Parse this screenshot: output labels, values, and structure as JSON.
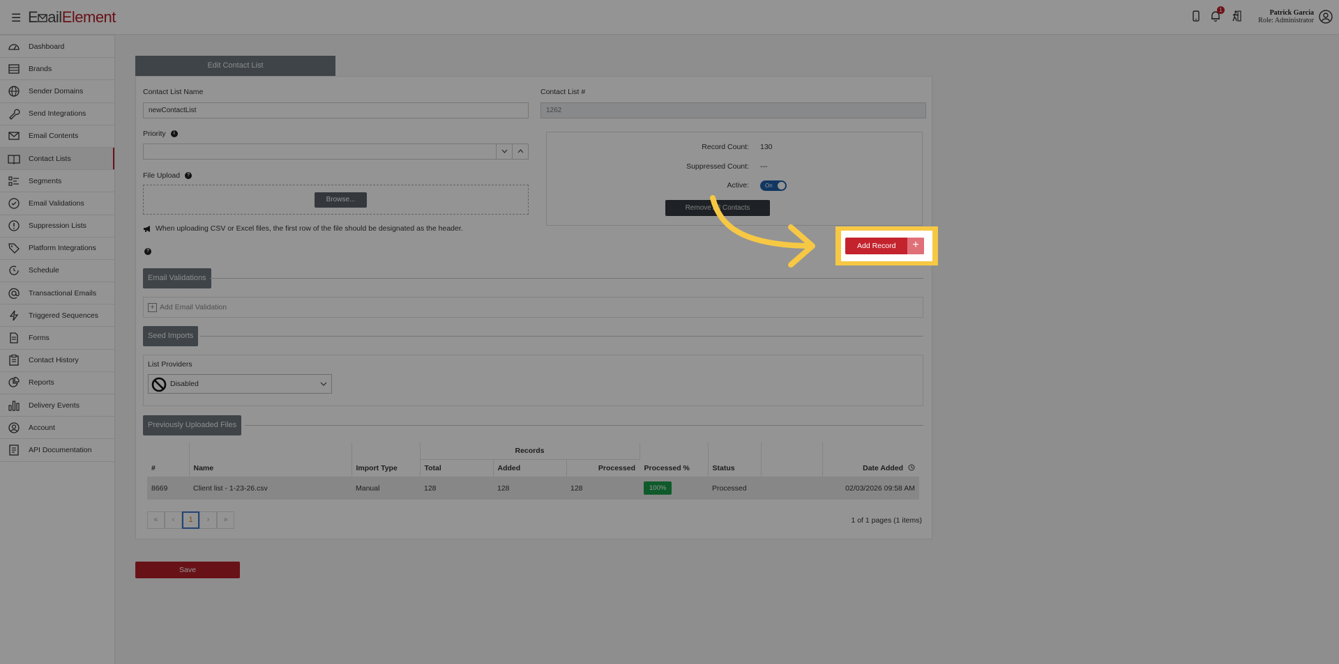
{
  "app": {
    "logo_part1": "E",
    "logo_part2": "ail",
    "logo_part3": "Element",
    "notification_count": "1",
    "user_name": "Patrick Garcia",
    "user_role": "Role: Administrator"
  },
  "sidebar": {
    "items": [
      {
        "label": "Dashboard",
        "icon": "dashboard-icon"
      },
      {
        "label": "Brands",
        "icon": "brands-icon"
      },
      {
        "label": "Sender Domains",
        "icon": "globe-icon"
      },
      {
        "label": "Send Integrations",
        "icon": "wrench-icon"
      },
      {
        "label": "Email Contents",
        "icon": "envelope-icon"
      },
      {
        "label": "Contact Lists",
        "icon": "book-icon"
      },
      {
        "label": "Segments",
        "icon": "segments-icon"
      },
      {
        "label": "Email Validations",
        "icon": "check-circle-icon"
      },
      {
        "label": "Suppression Lists",
        "icon": "exclamation-circle-icon"
      },
      {
        "label": "Platform Integrations",
        "icon": "tag-icon"
      },
      {
        "label": "Schedule",
        "icon": "schedule-icon"
      },
      {
        "label": "Transactional Emails",
        "icon": "at-icon"
      },
      {
        "label": "Triggered Sequences",
        "icon": "bolt-icon"
      },
      {
        "label": "Forms",
        "icon": "form-icon"
      },
      {
        "label": "Contact History",
        "icon": "clipboard-icon"
      },
      {
        "label": "Reports",
        "icon": "pie-chart-icon"
      },
      {
        "label": "Delivery Events",
        "icon": "bar-chart-icon"
      },
      {
        "label": "Account",
        "icon": "account-icon"
      },
      {
        "label": "API Documentation",
        "icon": "api-doc-icon"
      }
    ],
    "active_index": 5
  },
  "form": {
    "tab_title": "Edit Contact List",
    "name_label": "Contact List Name",
    "name_value": "newContactList",
    "number_label": "Contact List #",
    "number_value": "1262",
    "priority_label": "Priority",
    "priority_value": "",
    "file_upload_label": "File Upload",
    "browse_label": "Browse...",
    "upload_note": "When uploading CSV or Excel files, the first row of the file should be designated as the header."
  },
  "stats": {
    "record_count_label": "Record Count:",
    "record_count_value": "130",
    "suppressed_label": "Suppressed Count:",
    "suppressed_value": "---",
    "active_label": "Active:",
    "active_toggle": "On",
    "remove_all_label": "Remove All Contacts"
  },
  "validations": {
    "heading": "Email Validations",
    "add_label": "Add Email Validation"
  },
  "seed": {
    "heading": "Seed Imports",
    "providers_label": "List Providers",
    "providers_value": "Disabled"
  },
  "files": {
    "heading": "Previously Uploaded Files",
    "group_header": "Records",
    "columns": {
      "num": "#",
      "name": "Name",
      "import_type": "Import Type",
      "total": "Total",
      "added": "Added",
      "processed": "Processed",
      "processed_pct": "Processed %",
      "status": "Status",
      "date_added": "Date Added"
    },
    "rows": [
      {
        "num": "8669",
        "name": "Client list - 1-23-26.csv",
        "import_type": "Manual",
        "total": "128",
        "added": "128",
        "processed": "128",
        "processed_pct": "100%",
        "status": "Processed",
        "date_added": "02/03/2026 09:58 AM"
      }
    ],
    "pager": {
      "first": "«",
      "prev": "‹",
      "current": "1",
      "next": "›",
      "last": "»",
      "info": "1 of 1 pages (1 items)"
    }
  },
  "actions": {
    "save_label": "Save",
    "add_record_label": "Add Record",
    "add_record_plus": "+"
  },
  "colors": {
    "brand_red": "#b4202a",
    "highlight_yellow": "#f7c843",
    "success_green": "#1a9b4a",
    "toggle_blue": "#1f5fa8"
  }
}
